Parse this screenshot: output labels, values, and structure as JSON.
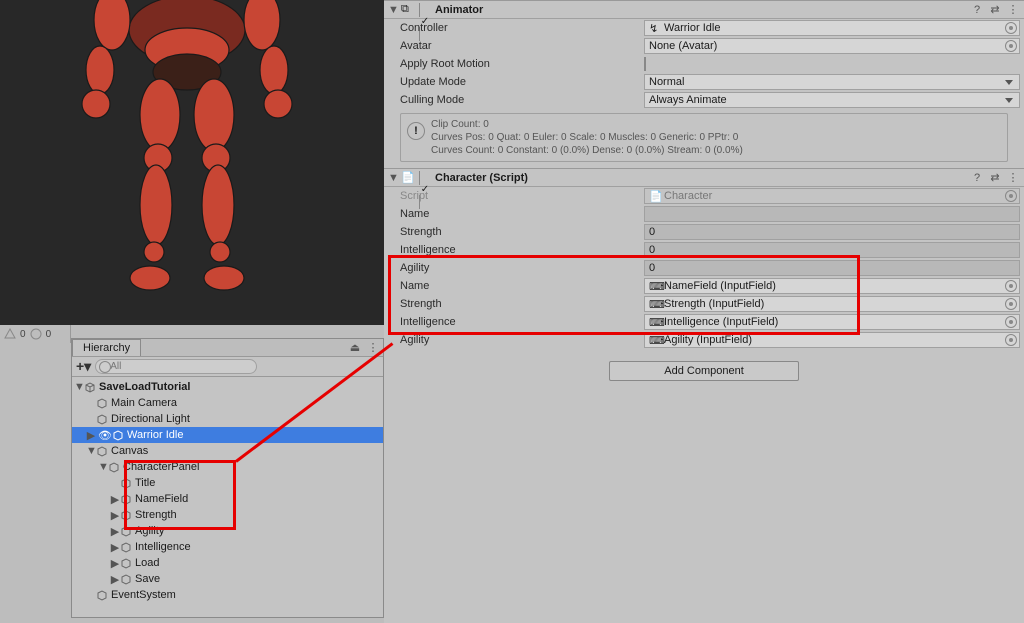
{
  "statusbar": {
    "warn_count": "0",
    "err_count": "0"
  },
  "hierarchy": {
    "tab_label": "Hierarchy",
    "search_placeholder": "All",
    "scene": "SaveLoadTutorial",
    "nodes": {
      "main_camera": "Main Camera",
      "directional_light": "Directional Light",
      "warrior_idle": "Warrior Idle",
      "canvas": "Canvas",
      "character_panel": "CharacterPanel",
      "title": "Title",
      "name_field": "NameField",
      "strength": "Strength",
      "agility": "Agility",
      "intelligence": "Intelligence",
      "load": "Load",
      "save": "Save",
      "event_system": "EventSystem"
    }
  },
  "inspector": {
    "animator": {
      "title": "Animator",
      "controller_label": "Controller",
      "controller_value": "Warrior Idle",
      "avatar_label": "Avatar",
      "avatar_value": "None (Avatar)",
      "apply_root_label": "Apply Root Motion",
      "update_mode_label": "Update Mode",
      "update_mode_value": "Normal",
      "culling_mode_label": "Culling Mode",
      "culling_mode_value": "Always Animate",
      "info_line1": "Clip Count: 0",
      "info_line2": "Curves Pos: 0 Quat: 0 Euler: 0 Scale: 0 Muscles: 0 Generic: 0 PPtr: 0",
      "info_line3": "Curves Count: 0 Constant: 0 (0.0%) Dense: 0 (0.0%) Stream: 0 (0.0%)"
    },
    "character": {
      "title": "Character (Script)",
      "script_label": "Script",
      "script_value": "Character",
      "name_label": "Name",
      "name_value": "",
      "strength_label": "Strength",
      "strength_value": "0",
      "intelligence_label": "Intelligence",
      "intelligence_value": "0",
      "agility_label": "Agility",
      "agility_value": "0",
      "ui_name_label": "Name",
      "ui_name_value": "NameField (InputField)",
      "ui_strength_label": "Strength",
      "ui_strength_value": "Strength (InputField)",
      "ui_intelligence_label": "Intelligence",
      "ui_intelligence_value": "Intelligence (InputField)",
      "ui_agility_label": "Agility",
      "ui_agility_value": "Agility (InputField)"
    },
    "add_component": "Add Component"
  }
}
